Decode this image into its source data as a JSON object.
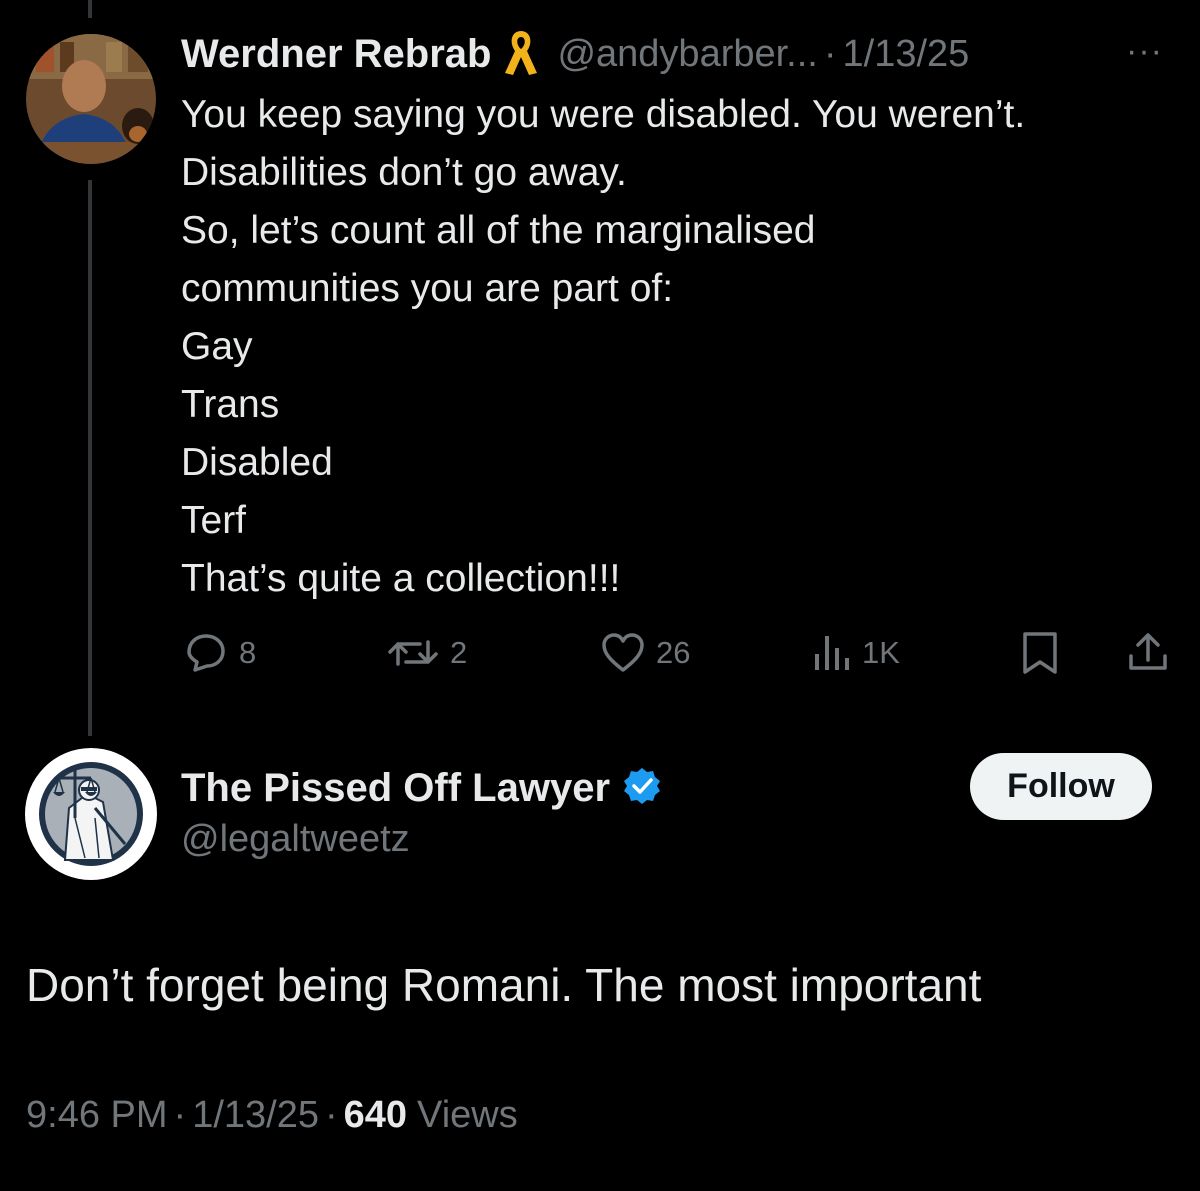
{
  "parent_tweet": {
    "author_name": "Werdner Rebrab",
    "handle": "@andybarber...",
    "separator": "·",
    "date": "1/13/25",
    "more_label": "···",
    "text_lines": [
      "You keep saying you were disabled. You weren’t.",
      "Disabilities don’t go away.",
      "So, let’s count all of the marginalised",
      "communities you are part of:",
      "Gay",
      "Trans",
      "Disabled",
      "Terf",
      "That’s quite a collection!!!"
    ],
    "actions": {
      "replies": "8",
      "reposts": "2",
      "likes": "26",
      "views": "1K"
    },
    "colors": {
      "ribbon": "#f2b21b"
    }
  },
  "main_tweet": {
    "author_name": "The Pissed Off Lawyer",
    "handle": "@legaltweetz",
    "follow_label": "Follow",
    "text": "Don’t forget being Romani. The most important",
    "time": "9:46 PM",
    "separator": "·",
    "date": "1/13/25",
    "views_count": "640",
    "views_label": "Views",
    "colors": {
      "verified": "#1d9bf0"
    }
  }
}
